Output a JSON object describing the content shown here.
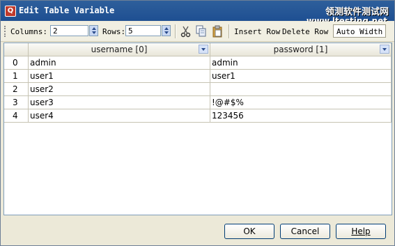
{
  "window": {
    "title": "Edit Table Variable",
    "app_icon_letter": "Q",
    "watermark_line1": "领测软件测试网",
    "watermark_line2": "www.ltesting.net"
  },
  "toolbar": {
    "columns_label": "Columns:",
    "columns_value": "2",
    "rows_label": "Rows:",
    "rows_value": "5",
    "insert_row": "Insert Row",
    "delete_row": "Delete Row",
    "auto_width": "Auto Width",
    "icons": [
      "scissors-icon",
      "copy-icon",
      "paste-icon"
    ]
  },
  "table": {
    "columns": [
      "username [0]",
      "password [1]"
    ],
    "rows": [
      {
        "index": "0",
        "cells": [
          "admin",
          "admin"
        ]
      },
      {
        "index": "1",
        "cells": [
          "user1",
          "user1"
        ]
      },
      {
        "index": "2",
        "cells": [
          "user2",
          ""
        ]
      },
      {
        "index": "3",
        "cells": [
          "user3",
          "!@#$%"
        ]
      },
      {
        "index": "4",
        "cells": [
          "user4",
          "123456"
        ]
      }
    ]
  },
  "buttons": {
    "ok": "OK",
    "cancel": "Cancel",
    "help": "Help"
  },
  "colors": {
    "titlebar": "#1e4f92",
    "dialog_bg": "#ece9d8"
  }
}
